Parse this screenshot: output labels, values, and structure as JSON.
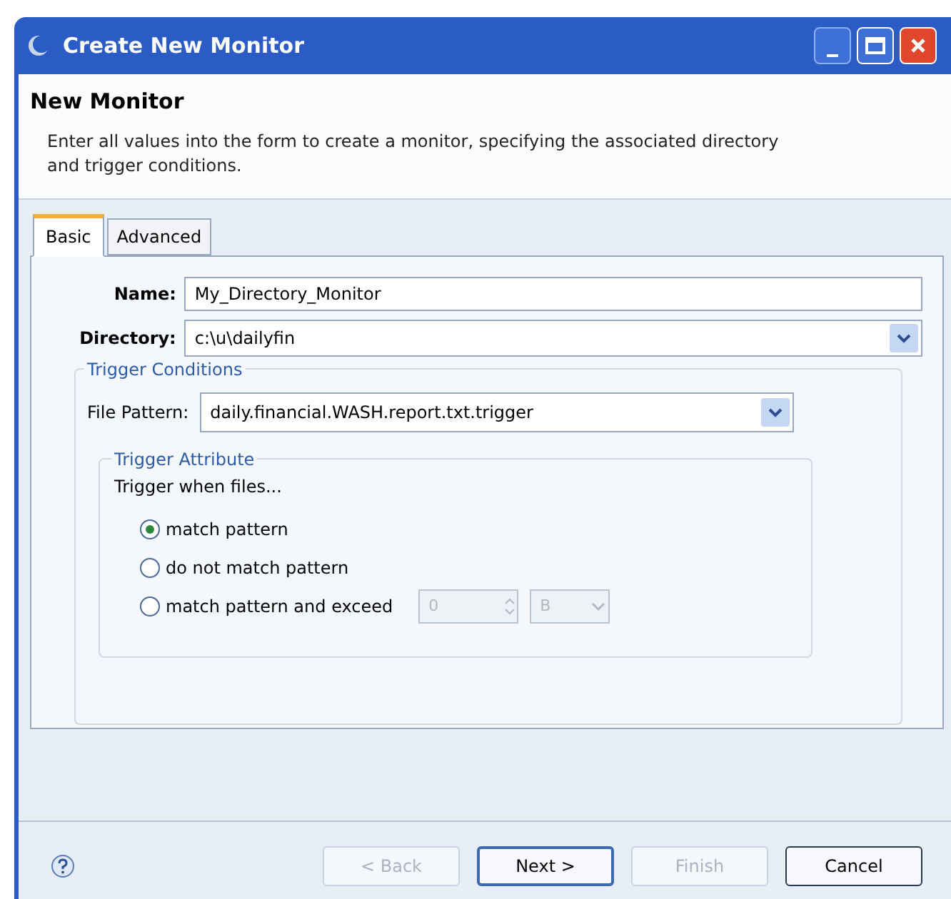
{
  "window": {
    "title": "Create New Monitor"
  },
  "header": {
    "title": "New Monitor",
    "description": "Enter all values into the form to create a monitor, specifying the associated directory and trigger conditions."
  },
  "tabs": [
    {
      "label": "Basic",
      "selected": true
    },
    {
      "label": "Advanced",
      "selected": false
    }
  ],
  "name_field": {
    "label": "Name:",
    "value": "My_Directory_Monitor"
  },
  "directory_field": {
    "label": "Directory:",
    "value": "c:\\u\\dailyfin"
  },
  "trigger_conditions": {
    "title": "Trigger Conditions",
    "file_pattern": {
      "label": "File Pattern:",
      "value": "daily.financial.WASH.report.txt.trigger"
    },
    "trigger_attribute": {
      "title": "Trigger Attribute",
      "prompt": "Trigger when files...",
      "options": [
        {
          "label": "match pattern",
          "selected": true
        },
        {
          "label": "do not match pattern",
          "selected": false
        },
        {
          "label": "match pattern and exceed",
          "selected": false
        }
      ],
      "size_value": {
        "value": "0",
        "disabled": true
      },
      "unit": {
        "value": "B",
        "disabled": true
      }
    }
  },
  "buttons": [
    {
      "label": "< Back",
      "disabled": true,
      "default": false
    },
    {
      "label": "Next >",
      "disabled": false,
      "default": true
    },
    {
      "label": "Finish",
      "disabled": true,
      "default": false
    },
    {
      "label": "Cancel",
      "disabled": false,
      "default": false
    }
  ]
}
